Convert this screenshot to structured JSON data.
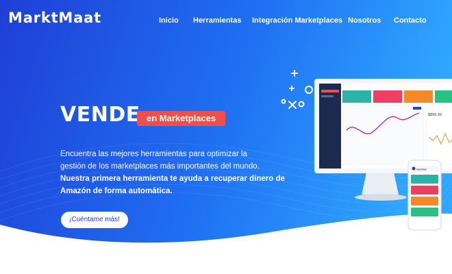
{
  "brand": {
    "logo_text": "MarktMaat"
  },
  "nav": {
    "items": [
      {
        "label": "Inicio"
      },
      {
        "label": "Herramientas"
      },
      {
        "label": "Integración Marketplaces"
      },
      {
        "label": "Nosotros"
      },
      {
        "label": "Contacto"
      }
    ]
  },
  "hero": {
    "headline": "VENDE",
    "badge": "en Marketplaces",
    "description_line1": "Encuentra las mejores herramientas para optimizar la",
    "description_line2": "gestión de los marketplaces más importantes del mundo.",
    "description_strong1": "Nuestra primera herramienta te ayuda a recuperar dinero de",
    "description_strong2": "Amazón de forma automática.",
    "cta_label": "¡Cuéntame más!"
  },
  "mockup": {
    "app_name": "MarktMaat",
    "price": "$899.39"
  },
  "colors": {
    "primary_blue": "#1f3fd6",
    "gradient_light": "#2fa6ff",
    "badge_red": "#ef4f4a",
    "card_teal": "#2bb3a8",
    "card_pink": "#ee3f62",
    "card_orange": "#f48a27",
    "card_green": "#26c281"
  }
}
